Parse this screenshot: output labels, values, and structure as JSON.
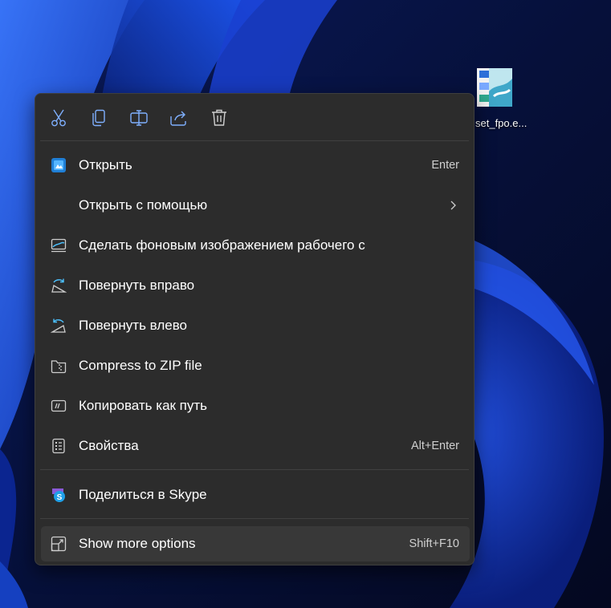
{
  "desktop": {
    "icon_label": "set_fpo.e..."
  },
  "toolbar": {
    "buttons": [
      {
        "name": "cut",
        "icon": "scissors-icon"
      },
      {
        "name": "copy",
        "icon": "copy-icon"
      },
      {
        "name": "rename",
        "icon": "rename-icon"
      },
      {
        "name": "share",
        "icon": "share-icon"
      },
      {
        "name": "delete",
        "icon": "trash-icon"
      }
    ]
  },
  "menu": {
    "items": [
      {
        "label": "Открыть",
        "shortcut": "Enter",
        "icon": "photos-app-icon"
      },
      {
        "label": "Открыть с помощью",
        "shortcut": "",
        "icon": "",
        "submenu": true
      },
      {
        "label": "Сделать фоновым изображением рабочего с",
        "shortcut": "",
        "icon": "desktop-background-icon"
      },
      {
        "label": "Повернуть вправо",
        "shortcut": "",
        "icon": "rotate-right-icon"
      },
      {
        "label": "Повернуть влево",
        "shortcut": "",
        "icon": "rotate-left-icon"
      },
      {
        "label": "Compress to ZIP file",
        "shortcut": "",
        "icon": "zip-folder-icon"
      },
      {
        "label": "Копировать как путь",
        "shortcut": "",
        "icon": "copy-path-icon"
      },
      {
        "label": "Свойства",
        "shortcut": "Alt+Enter",
        "icon": "properties-icon"
      },
      {
        "label": "Поделиться в Skype",
        "shortcut": "",
        "icon": "skype-icon"
      },
      {
        "label": "Show more options",
        "shortcut": "Shift+F10",
        "icon": "show-more-icon"
      }
    ]
  },
  "colors": {
    "menu_bg": "#2c2c2c",
    "accent": "#4cc2ff",
    "text": "#ffffff"
  }
}
